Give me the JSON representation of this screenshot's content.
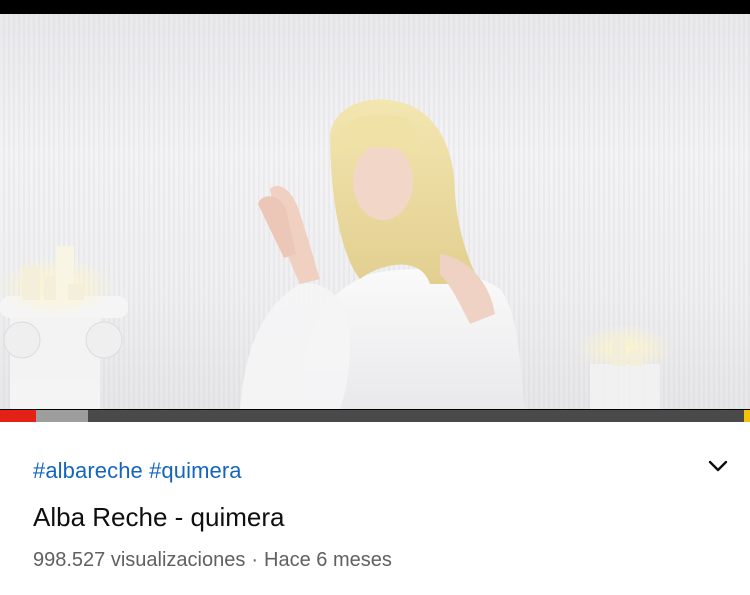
{
  "video": {
    "progress_played": 0.048,
    "progress_buffered": 0.117
  },
  "info": {
    "hashtags": "#albareche #quimera",
    "title": "Alba Reche - quimera",
    "views": "998.527 visualizaciones",
    "separator": "·",
    "age": "Hace 6 meses",
    "expand_icon": "chevron-down-icon"
  },
  "colors": {
    "progress_played": "#e52117",
    "hashtag_link": "#1565c0",
    "ad_marker": "#f2c500"
  }
}
